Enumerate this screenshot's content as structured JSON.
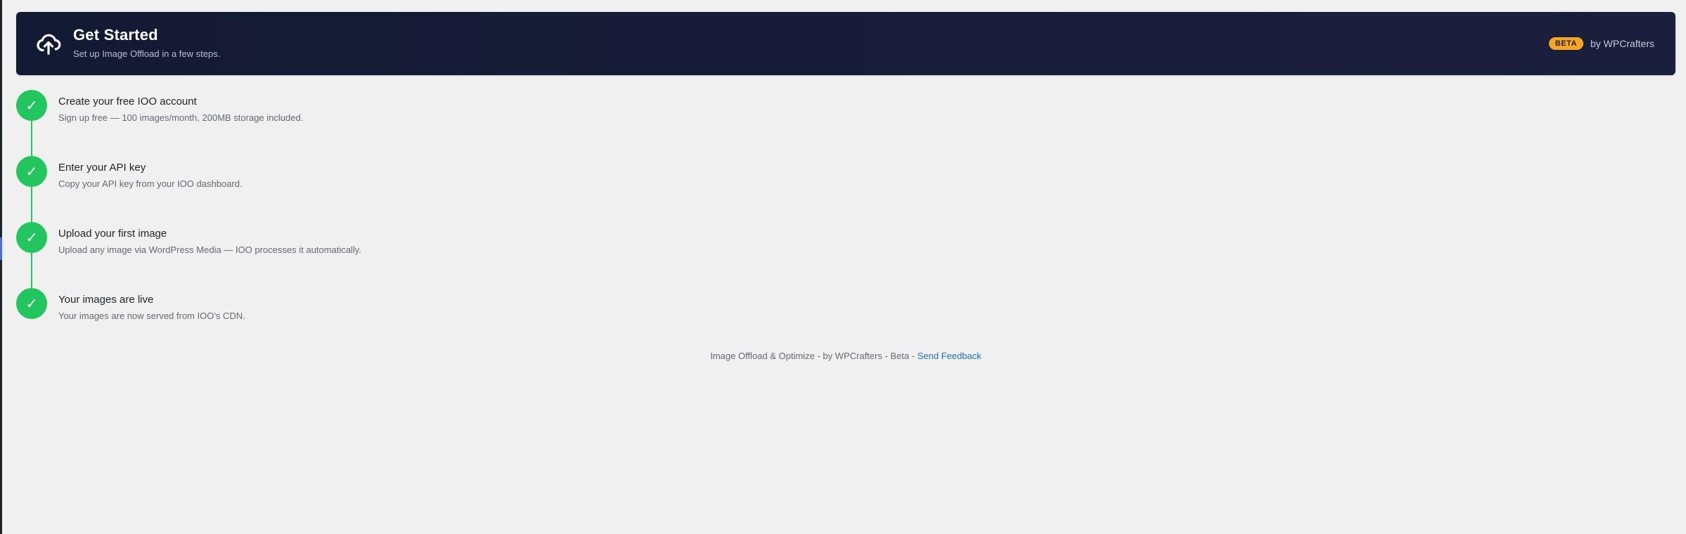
{
  "header": {
    "title": "Get Started",
    "subtitle": "Set up Image Offload in a few steps.",
    "icon": "cloud-upload-icon",
    "badge": "BETA",
    "by_text": "by WPCrafters",
    "badge_color": "#f5a623"
  },
  "steps": [
    {
      "title": "Create your free IOO account",
      "description": "Sign up free — 100 images/month, 200MB storage included.",
      "status": "complete",
      "icon": "checkmark-icon"
    },
    {
      "title": "Enter your API key",
      "description": "Copy your API key from your IOO dashboard.",
      "status": "complete",
      "icon": "checkmark-icon"
    },
    {
      "title": "Upload your first image",
      "description": "Upload any image via WordPress Media — IOO processes it automatically.",
      "status": "complete",
      "icon": "checkmark-icon"
    },
    {
      "title": "Your images are live",
      "description": "Your images are now served from IOO's CDN.",
      "status": "complete",
      "icon": "checkmark-icon"
    }
  ],
  "step_check_glyph": "✓",
  "colors": {
    "complete": "#22c55e",
    "header_bg": "#1a1f3d",
    "link": "#2271b1"
  },
  "footer": {
    "text": "Image Offload & Optimize - by WPCrafters - Beta - ",
    "link_label": "Send Feedback"
  }
}
